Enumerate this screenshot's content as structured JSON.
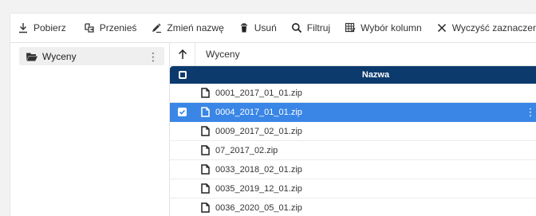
{
  "toolbar": {
    "download_label": "Pobierz",
    "move_label": "Przenieś",
    "rename_label": "Zmień nazwę",
    "delete_label": "Usuń",
    "filter_label": "Filtruj",
    "columns_label": "Wybór kolumn",
    "clear_selection_label": "Wyczyść zaznaczenie"
  },
  "nav": {
    "folder_label": "Wyceny",
    "menu_glyph": "⋮"
  },
  "breadcrumb": {
    "current": "Wyceny"
  },
  "grid": {
    "column_name": "Nazwa",
    "rows": [
      {
        "name": "0001_2017_01_01.zip",
        "selected": false
      },
      {
        "name": "0004_2017_01_01.zip",
        "selected": true
      },
      {
        "name": "0009_2017_02_01.zip",
        "selected": false
      },
      {
        "name": "07_2017_02.zip",
        "selected": false
      },
      {
        "name": "0033_2018_02_01.zip",
        "selected": false
      },
      {
        "name": "0035_2019_12_01.zip",
        "selected": false
      },
      {
        "name": "0036_2020_05_01.zip",
        "selected": false
      }
    ],
    "row_menu_glyph": "⋮"
  },
  "colors": {
    "header_bg": "#0c3a6d",
    "selected_row_bg": "#3a86e6"
  }
}
